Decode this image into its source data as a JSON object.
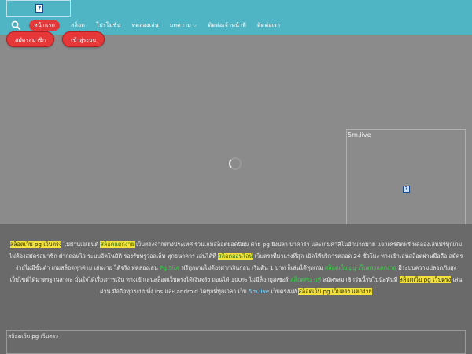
{
  "header": {
    "logo_icon": "broken-image-icon",
    "logo_glyph": "?",
    "nav": [
      {
        "label": "หน้าแรก",
        "active": true
      },
      {
        "label": "สล็อต"
      },
      {
        "label": "โปรโมชั่น"
      },
      {
        "label": "ทดลองเล่น"
      },
      {
        "label": "บทความ",
        "has_dropdown": true
      },
      {
        "label": "ติดต่อเจ้าหน้าที่"
      },
      {
        "label": "ติดต่อเรา"
      }
    ],
    "buttons": {
      "register": "สมัครสมาชิก",
      "login": "เข้าสู่ระบบ"
    }
  },
  "side_panel": {
    "label": "5m.live",
    "glyph": "?"
  },
  "article": {
    "segments": [
      {
        "t": "สล็อตเว็บ pg เว็บตรง",
        "c": "hl-y"
      },
      {
        "t": " ไม่ผ่านเอเย่นต์ "
      },
      {
        "t": "สล็อตแตกง่าย",
        "c": "hl-gb"
      },
      {
        "t": " เว็บตรงจากต่างประเทศ รวมเกมสล็อตยอดนิยม ค่าย pg ยิงปลา บาคาร่า และเกมคาสิโนอีกมากมาย แจกเครดิตฟรี ทดลองเล่นฟรีทุกเกมไม่ต้องสมัครสมาชิก ฝากถอนไว ระบบอัตโนมัติ รองรับทรูวอลเล็ท ทุกธนาคาร เล่นได้ที่ "
      },
      {
        "t": "สล็อตออนไลน์",
        "c": "hl-gb"
      },
      {
        "t": " เว็บตรงที่มาแรงที่สุด เปิดให้บริการตลอด 24 ชั่วโมง ทางเข้าเล่นสล็อตผ่านมือถือ สมัครง่ายไม่มีขั้นต่ำ เกมสล็อตทุกค่าย เล่นง่าย ได้จริง ทดลองเล่น "
      },
      {
        "t": "Pg Slot",
        "c": "hl-g"
      },
      {
        "t": " ฟรีทุกเกมไม่ต้องฝากเงินก่อน เริ่มต้น 1 บาท ก็เล่นได้ทุกเกม "
      },
      {
        "t": "สล็อตเว็บ pg เว็บตรงแตกง่าย",
        "c": "hl-g"
      },
      {
        "t": " มีระบบความปลอดภัยสูง เว็บไซต์ได้มาตรฐานสากล มั่นใจได้เรื่องการเงิน ทางเข้าเล่นสล็อตเว็บตรงได้เงินจริง ถอนได้ 100% ไม่มีล็อกยูสเซอร์ "
      },
      {
        "t": "สล็อตPG แท้",
        "c": "hl-g"
      },
      {
        "t": " สมัครสมาชิกวันนี้รับโบนัสทันที "
      },
      {
        "t": "สล็อตเว็บ pg เว็บตรง",
        "c": "hl-y"
      },
      {
        "t": " เล่นผ่าน มือถือทุกระบบทั้ง ios และ android ได้ทุกที่ทุกเวลา เว็บ "
      },
      {
        "t": "5m.live",
        "c": "hl-blue"
      },
      {
        "t": " เว็บตรงแท้ "
      },
      {
        "t": "สล็อตเว็บ pg เว็บตรง แตกง่าย",
        "c": "hl-y"
      }
    ]
  },
  "bottom_box": {
    "label": "สล็อตเว็บ pg เว็บตรง"
  }
}
